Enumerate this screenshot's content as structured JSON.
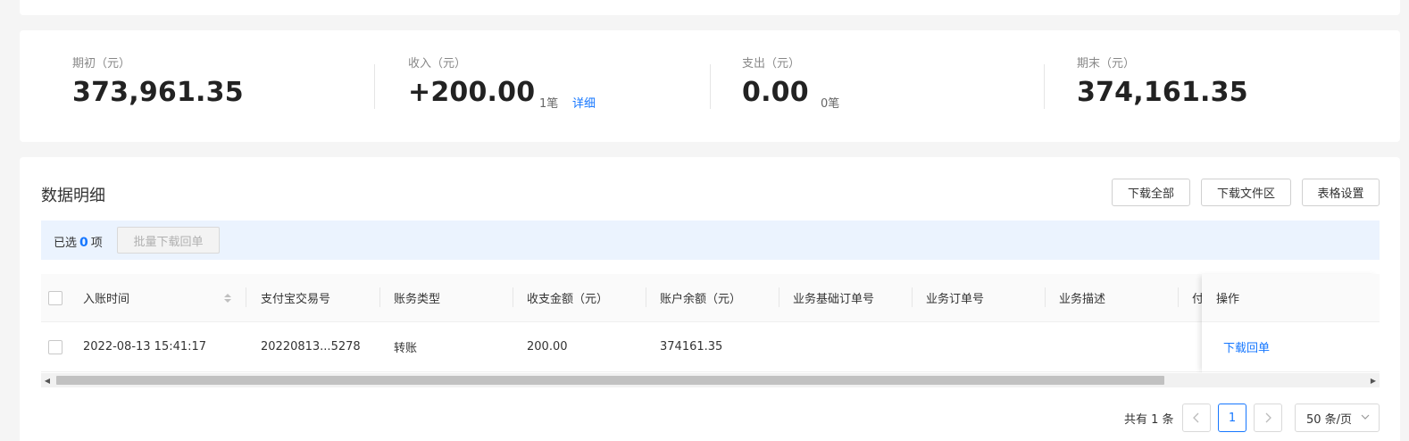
{
  "summary": {
    "opening": {
      "label": "期初（元）",
      "value": "373,961.35"
    },
    "income": {
      "label": "收入（元）",
      "value": "+200.00",
      "count": "1笔",
      "detail_link": "详细"
    },
    "expense": {
      "label": "支出（元）",
      "value": "0.00",
      "count": "0笔"
    },
    "closing": {
      "label": "期末（元）",
      "value": "374,161.35"
    }
  },
  "detail": {
    "title": "数据明细",
    "buttons": {
      "download_all": "下载全部",
      "download_area": "下载文件区",
      "table_settings": "表格设置"
    },
    "selection": {
      "prefix": "已选",
      "count": "0",
      "suffix": "项",
      "batch_button": "批量下载回单"
    }
  },
  "table": {
    "columns": {
      "time": "入账时间",
      "alipay_no": "支付宝交易号",
      "type": "账务类型",
      "amount": "收支金额（元）",
      "balance": "账户余额（元）",
      "base_order": "业务基础订单号",
      "biz_order": "业务订单号",
      "desc": "业务描述",
      "partial": "付",
      "action": "操作"
    },
    "rows": [
      {
        "time": "2022-08-13 15:41:17",
        "alipay_no": "20220813...5278",
        "type": "转账",
        "amount": "200.00",
        "balance": "374161.35",
        "base_order": "",
        "biz_order": "",
        "desc": "",
        "action": "下载回单"
      }
    ]
  },
  "pagination": {
    "total": "共有 1 条",
    "current_page": "1",
    "page_size": "50 条/页"
  },
  "icons": {
    "prev": "chevron-left-icon",
    "next": "chevron-right-icon",
    "sort": "sort-icon",
    "dropdown": "chevron-down-icon"
  },
  "colors": {
    "accent": "#1677ff",
    "selection_bg": "#ebf3fe"
  }
}
